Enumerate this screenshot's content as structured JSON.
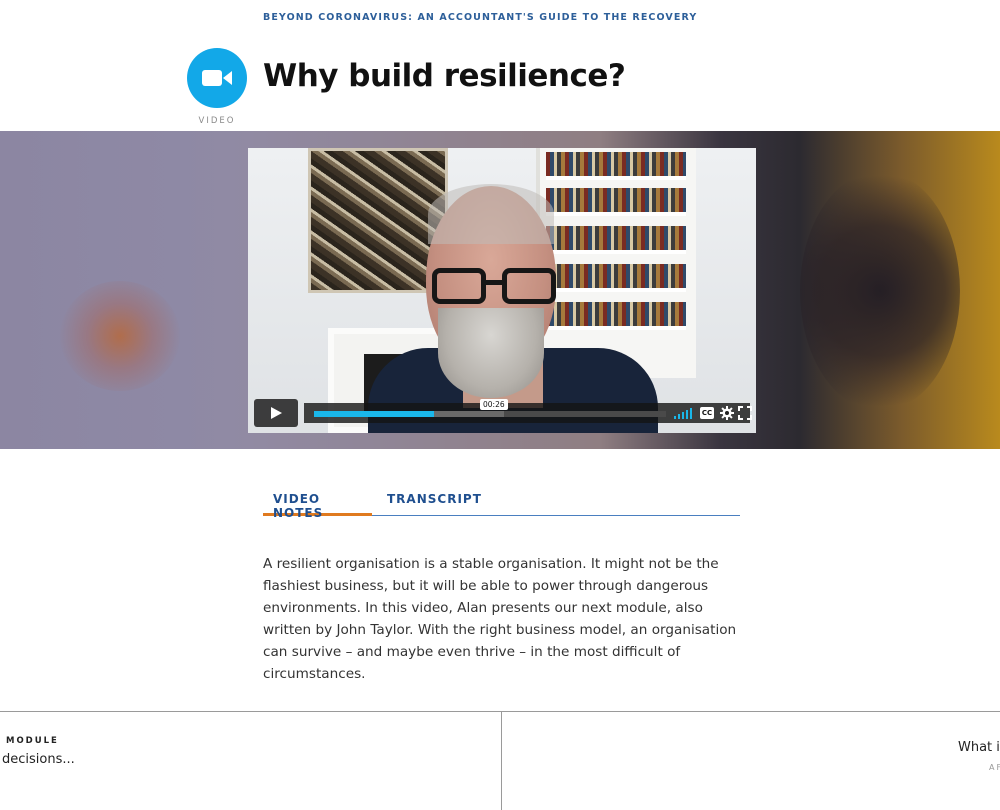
{
  "header": {
    "course_label": "BEYOND CORONAVIRUS: AN ACCOUNTANT'S GUIDE TO THE RECOVERY",
    "badge_label": "VIDEO",
    "badge_icon": "video-camera-icon",
    "title": "Why build resilience?"
  },
  "player": {
    "current_time": "00:26",
    "progress_fraction": 0.34,
    "buffered_fraction": 0.54,
    "cc_label": "CC",
    "accent_color": "#1ab7ea"
  },
  "tabs": [
    {
      "label": "VIDEO NOTES",
      "active": true
    },
    {
      "label": "TRANSCRIPT",
      "active": false
    }
  ],
  "video_notes": "A resilient organisation is a stable organisation. It might not be the flashiest business, but it will be able to power through dangerous environments. In this video, Alan presents our next module, also written by John Taylor. With the right business model, an organisation can survive – and maybe even thrive – in the most difficult of circumstances.",
  "bottom_nav": {
    "prev_kicker": "MODULE",
    "prev_title": "decisions...",
    "next_title": "What is",
    "next_kicker": "AF"
  },
  "colors": {
    "brand_blue": "#12a8e8",
    "tab_text": "#1f4f8f",
    "tab_active_underline": "#e07a1f"
  }
}
